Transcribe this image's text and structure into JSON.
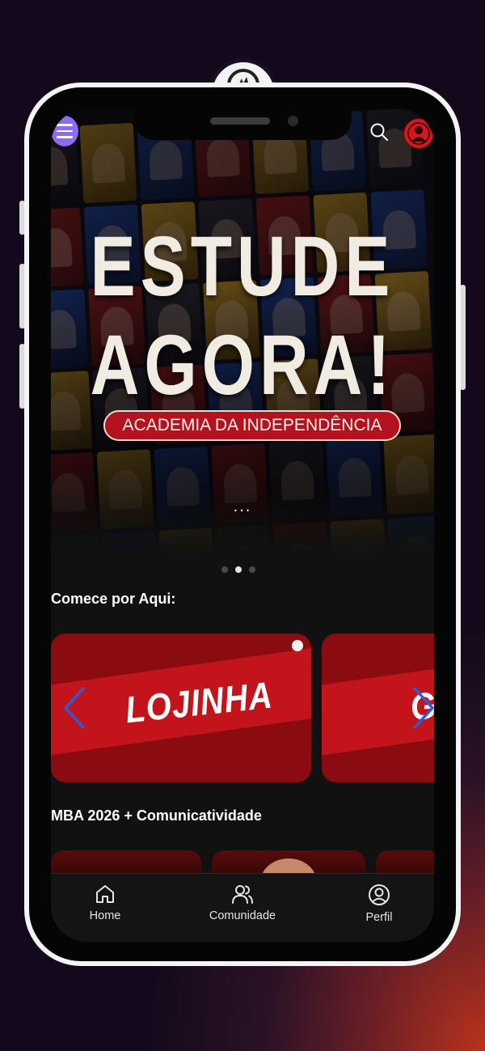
{
  "header": {
    "menu_icon": "hamburger-menu-icon",
    "search_icon": "search-icon",
    "avatar_icon": "user-avatar-icon"
  },
  "hero": {
    "title_line1": "ESTUDE",
    "title_line2": "AGORA!",
    "subtitle": "ACADEMIA DA INDEPENDÊNCIA",
    "more_label": "...",
    "carousel_pages": 3,
    "carousel_active_index": 1
  },
  "sections": [
    {
      "title": "Comece por Aqui:",
      "cards": [
        {
          "label": "LOJINHA"
        },
        {
          "label": "GI"
        }
      ]
    },
    {
      "title": "MBA 2026 + Comunicatividade"
    }
  ],
  "tabbar": {
    "items": [
      {
        "label": "Home",
        "icon": "home-icon"
      },
      {
        "label": "Comunidade",
        "icon": "users-icon"
      },
      {
        "label": "Perfil",
        "icon": "profile-icon"
      }
    ]
  },
  "colors": {
    "accent_purple": "#8e6bf0",
    "brand_red": "#c3141c",
    "background": "#111111"
  }
}
